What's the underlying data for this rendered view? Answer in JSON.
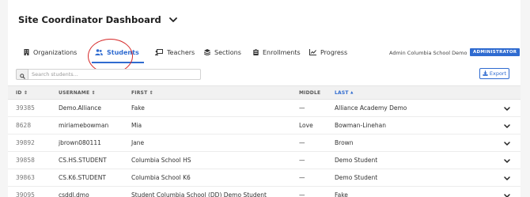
{
  "header": {
    "title": "Site Coordinator Dashboard"
  },
  "tabs": [
    {
      "label": "Organizations",
      "icon": "building-icon",
      "active": false
    },
    {
      "label": "Students",
      "icon": "users-icon",
      "active": true
    },
    {
      "label": "Teachers",
      "icon": "chalkboard-teacher-icon",
      "active": false
    },
    {
      "label": "Sections",
      "icon": "layers-icon",
      "active": false
    },
    {
      "label": "Enrollments",
      "icon": "clipboard-icon",
      "active": false
    },
    {
      "label": "Progress",
      "icon": "chart-line-icon",
      "active": false
    }
  ],
  "user": {
    "name": "Admin Columbia School Demo",
    "role_badge": "ADMINISTRATOR"
  },
  "toolbar": {
    "search_placeholder": "Search students...",
    "export_label": "Export"
  },
  "table": {
    "columns": [
      {
        "label": "ID",
        "sort_icon": "⇕"
      },
      {
        "label": "USERNAME",
        "sort_icon": "⇕"
      },
      {
        "label": "FIRST",
        "sort_icon": "⇕"
      },
      {
        "label": "MIDDLE",
        "sort_icon": ""
      },
      {
        "label": "LAST",
        "sort_icon": "▲"
      }
    ],
    "rows": [
      {
        "id": "39385",
        "username": "Demo.Alliance",
        "first": "Fake",
        "middle": "—",
        "last": "Alliance Academy Demo"
      },
      {
        "id": "8628",
        "username": "miriamebowman",
        "first": "Mia",
        "middle": "Love",
        "last": "Bowman-Linehan"
      },
      {
        "id": "39892",
        "username": "jbrown080111",
        "first": "Jane",
        "middle": "—",
        "last": "Brown"
      },
      {
        "id": "39858",
        "username": "CS.HS.STUDENT",
        "first": "Columbia School HS",
        "middle": "—",
        "last": "Demo Student"
      },
      {
        "id": "39863",
        "username": "CS.K6.STUDENT",
        "first": "Columbia School K6",
        "middle": "—",
        "last": "Demo Student"
      },
      {
        "id": "39095",
        "username": "csddl.dmo",
        "first": "Student Columbia School (DD) Demo Student",
        "middle": "—",
        "last": "Fake"
      }
    ]
  },
  "colors": {
    "accent": "#2f6bd0",
    "annotation_circle": "#d62a2a"
  }
}
